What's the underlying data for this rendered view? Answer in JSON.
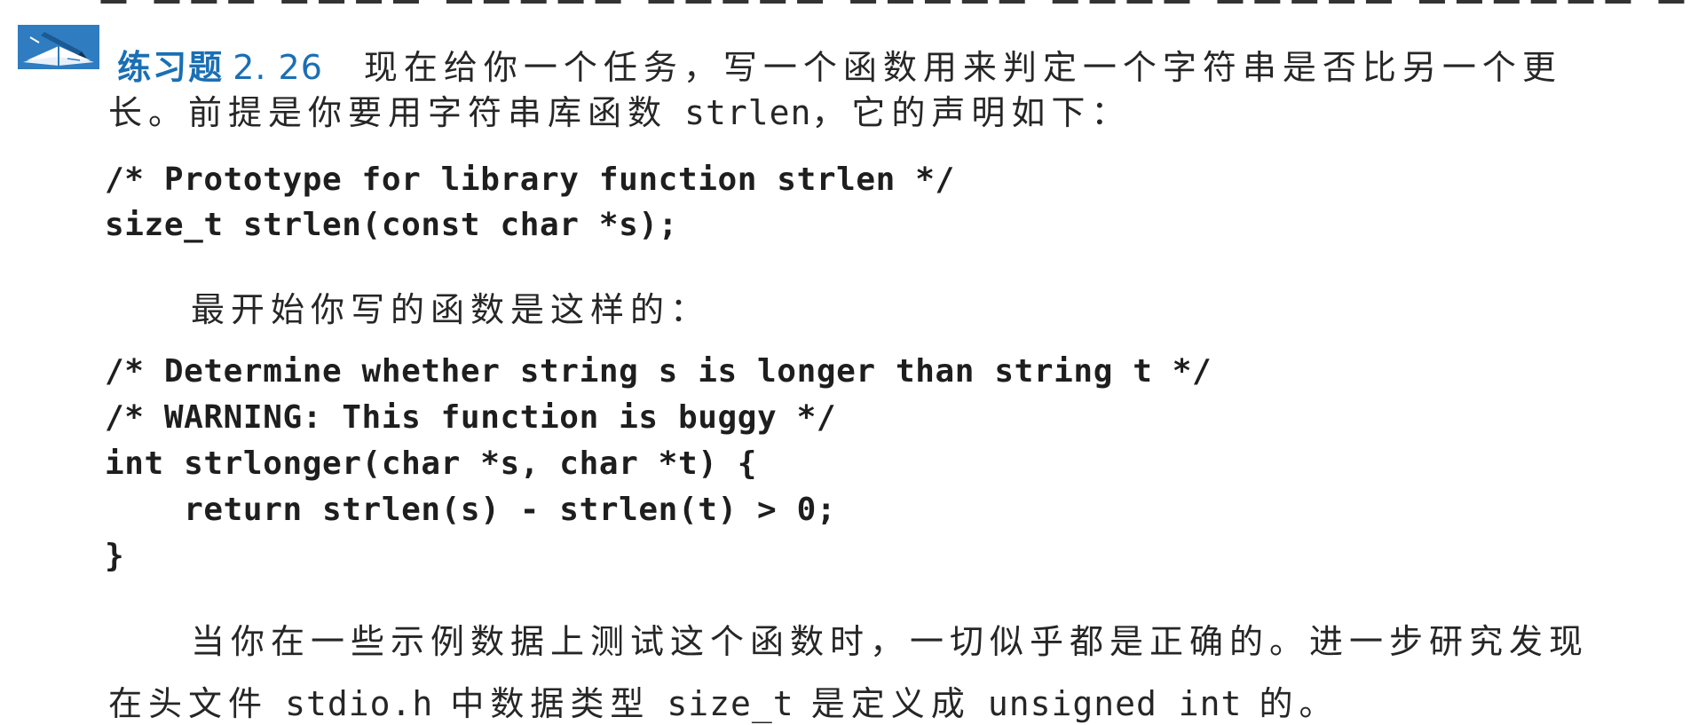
{
  "exercise": {
    "label": "练习题",
    "number": "2. 26",
    "icon": "pencil-writing-icon",
    "accent_color": "#1a6fb4"
  },
  "paragraph1": {
    "line1": "现在给你一个任务，写一个函数用来判定一个字符串是否比另一个更",
    "line2_a": "长。前提是你要用字符串库函数 ",
    "line2_code": "strlen",
    "line2_b": "，它的声明如下："
  },
  "code_block_1": [
    "/* Prototype for library function strlen */",
    "size_t strlen(const char *s);"
  ],
  "paragraph2": {
    "line1": "最开始你写的函数是这样的："
  },
  "code_block_2": [
    "/* Determine whether string s is longer than string t */",
    "/* WARNING: This function is buggy */",
    "int strlonger(char *s, char *t) {",
    "    return strlen(s) - strlen(t) > 0;",
    "}"
  ],
  "paragraph3": {
    "line1": "当你在一些示例数据上测试这个函数时，一切似乎都是正确的。进一步研究发现",
    "line2_a": "在头文件 ",
    "line2_code1": "stdio.h",
    "line2_b": " 中数据类型 ",
    "line2_code2": "size_t",
    "line2_c": " 是定义成 ",
    "line2_code3": "unsigned int",
    "line2_d": " 的。"
  }
}
